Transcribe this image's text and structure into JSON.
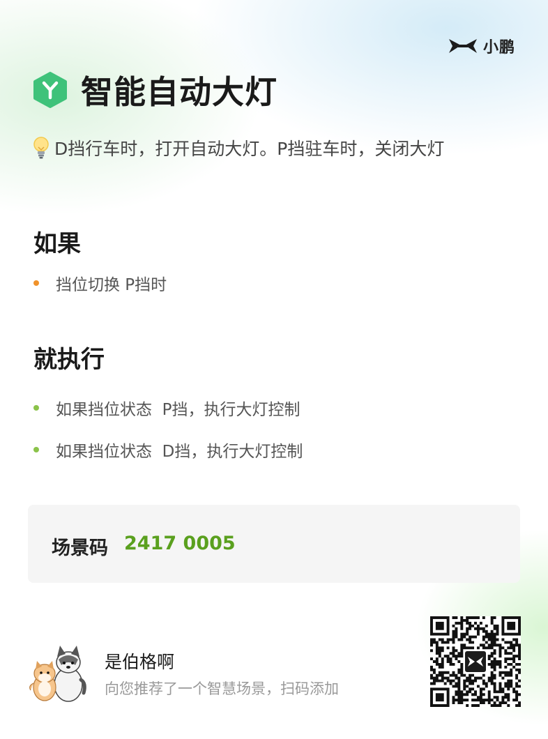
{
  "brand": {
    "name": "小鹏",
    "logo_icon": "xpeng-logo-icon"
  },
  "scene": {
    "title": "智能自动大灯",
    "icon": "scene-y-icon",
    "icon_color": "#3fc27a",
    "bulb_icon": "lightbulb-icon",
    "description": "D挡行车时，打开自动大灯。P挡驻车时，关闭大灯"
  },
  "conditions": {
    "heading": "如果",
    "items": [
      {
        "text": "挡位切换 P挡时",
        "dot_color": "#f0922b"
      }
    ]
  },
  "actions": {
    "heading": "就执行",
    "items": [
      {
        "text": "如果挡位状态  P挡，执行大灯控制",
        "dot_color": "#8bc34a"
      },
      {
        "text": "如果挡位状态  D挡，执行大灯控制",
        "dot_color": "#8bc34a"
      }
    ]
  },
  "scene_code": {
    "label": "场景码",
    "value": "2417 0005",
    "value_color": "#5aa01e"
  },
  "sharer": {
    "name": "是伯格啊",
    "message": "向您推荐了一个智慧场景，扫码添加",
    "avatar_icon": "cat-dog-avatar-icon"
  },
  "qr": {
    "icon": "qr-code-icon",
    "center_icon": "xpeng-logo-icon"
  }
}
